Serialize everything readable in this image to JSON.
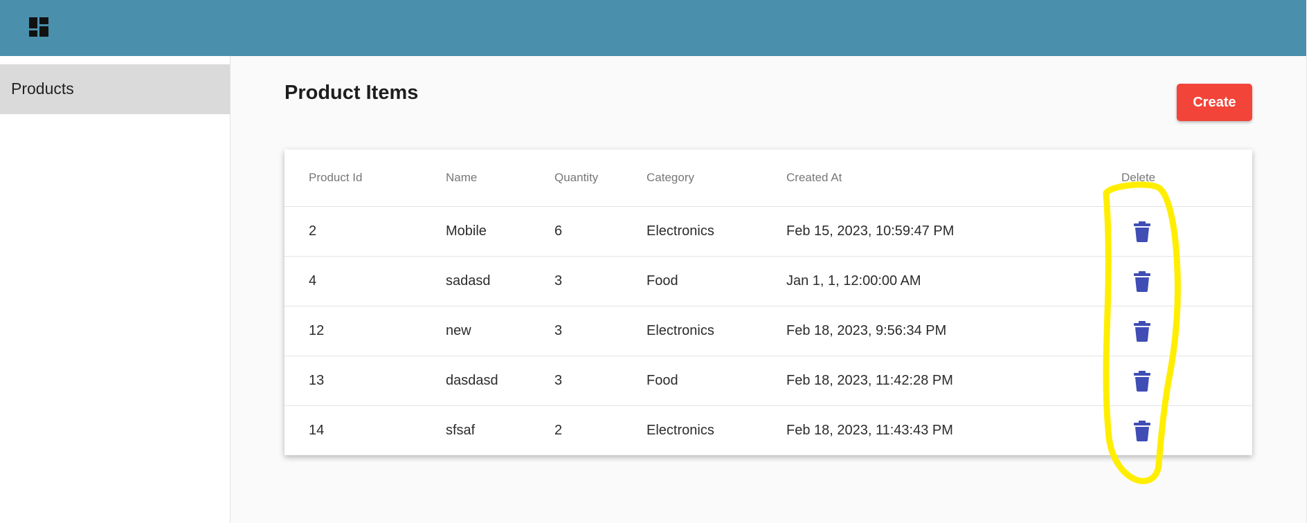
{
  "header": {
    "logo_icon": "dashboard-icon",
    "background": "#4a8fac"
  },
  "sidebar": {
    "items": [
      {
        "label": "Products",
        "active": true
      }
    ]
  },
  "main": {
    "title": "Product Items",
    "create_label": "Create",
    "create_color": "#f24439",
    "table": {
      "columns": [
        "Product Id",
        "Name",
        "Quantity",
        "Category",
        "Created At",
        "Delete"
      ],
      "rows": [
        {
          "id": "2",
          "name": "Mobile",
          "quantity": "6",
          "category": "Electronics",
          "created_at": "Feb 15, 2023, 10:59:47 PM"
        },
        {
          "id": "4",
          "name": "sadasd",
          "quantity": "3",
          "category": "Food",
          "created_at": "Jan 1, 1, 12:00:00 AM"
        },
        {
          "id": "12",
          "name": "new",
          "quantity": "3",
          "category": "Electronics",
          "created_at": "Feb 18, 2023, 9:56:34 PM"
        },
        {
          "id": "13",
          "name": "dasdasd",
          "quantity": "3",
          "category": "Food",
          "created_at": "Feb 18, 2023, 11:42:28 PM"
        },
        {
          "id": "14",
          "name": "sfsaf",
          "quantity": "2",
          "category": "Electronics",
          "created_at": "Feb 18, 2023, 11:43:43 PM"
        }
      ],
      "delete_icon": "trash-icon",
      "delete_icon_color": "#3f4db5"
    }
  },
  "annotation": {
    "color": "#ffee00",
    "shape": "freehand-loop-around-delete-column"
  }
}
